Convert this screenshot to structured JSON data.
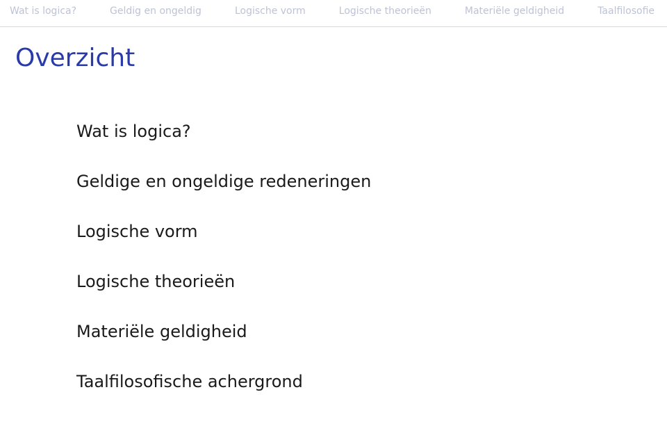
{
  "nav": {
    "items": [
      "Wat is logica?",
      "Geldig en ongeldig",
      "Logische vorm",
      "Logische theorieën",
      "Materiële geldigheid",
      "Taalfilosofie"
    ]
  },
  "title": "Overzicht",
  "outline": {
    "items": [
      "Wat is logica?",
      "Geldige en ongeldige redeneringen",
      "Logische vorm",
      "Logische theorieën",
      "Materiële geldigheid",
      "Taalfilosofische achergrond"
    ]
  }
}
